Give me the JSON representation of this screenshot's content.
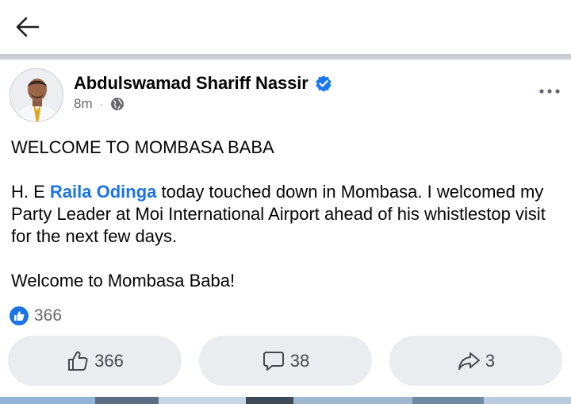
{
  "header": {
    "back_icon": "arrow-left-icon"
  },
  "post": {
    "author": "Abdulswamad Shariff Nassir",
    "verified": true,
    "time": "8m",
    "separator": "·",
    "audience_icon": "globe-icon",
    "more_icon": "ellipsis-icon",
    "body": {
      "heading": "WELCOME TO MOMBASA BABA",
      "p2_prefix": "H. E ",
      "mention": "Raila Odinga",
      "p2_suffix": " today touched down in Mombasa. I welcomed my Party Leader at Moi International Airport ahead of his whistlestop visit for the next few days.",
      "closing": "Welcome to Mombasa Baba!"
    },
    "reactions": {
      "icon": "like-reaction-icon",
      "count": "366"
    },
    "actions": {
      "like_count": "366",
      "comment_count": "38",
      "share_count": "3"
    }
  },
  "colors": {
    "accent": "#1b74e4",
    "verified": "#1877f2",
    "button_bg": "#eaecef",
    "secondary_text": "#65676b"
  }
}
